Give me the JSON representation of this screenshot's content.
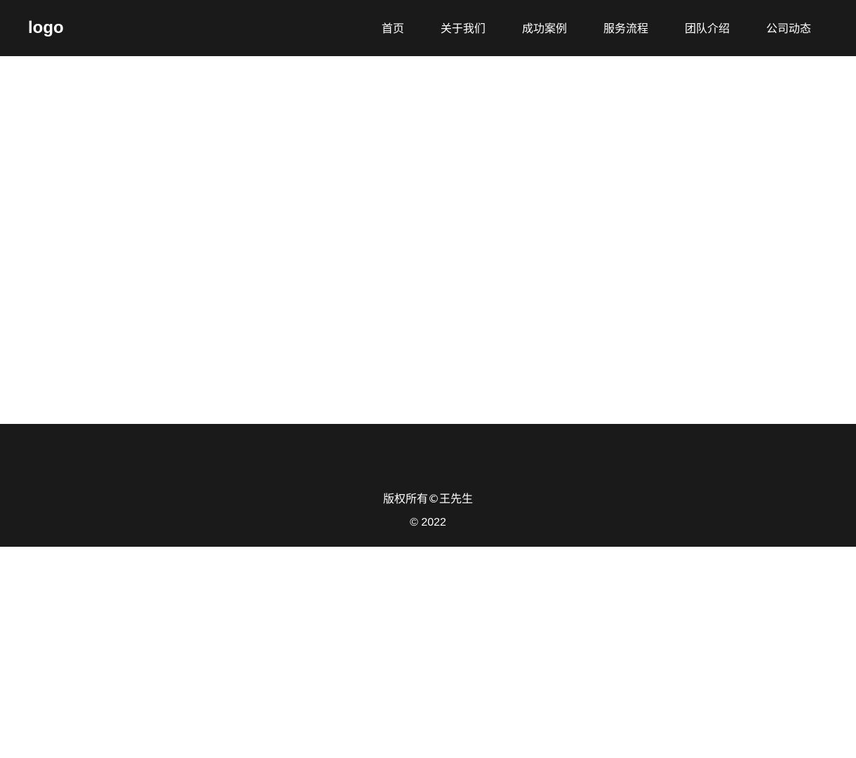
{
  "header": {
    "logo": "logo",
    "nav": [
      {
        "label": "首页"
      },
      {
        "label": "关于我们"
      },
      {
        "label": "成功案例"
      },
      {
        "label": "服务流程"
      },
      {
        "label": "团队介绍"
      },
      {
        "label": "公司动态"
      }
    ]
  },
  "footer": {
    "copyright": "版权所有©王先生",
    "year": "© 2022"
  },
  "colors": {
    "header_bg": "#1a1a1a",
    "footer_bg": "#1a1a1a",
    "text": "#ffffff",
    "page_bg": "#ffffff"
  }
}
